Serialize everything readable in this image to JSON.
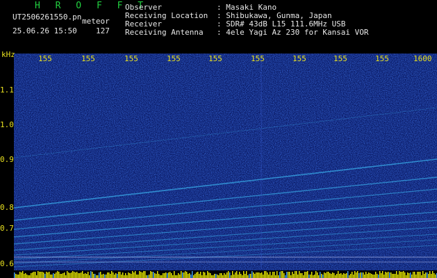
{
  "title": "H R O F F T",
  "file": {
    "name": "UT2506261550.pn",
    "kind": "meteor",
    "datetime": "25.06.26 15:50",
    "count": "127"
  },
  "info": [
    {
      "label": "Observer",
      "value": ": Masaki Kano"
    },
    {
      "label": "Receiving Location",
      "value": ": Shibukawa, Gunma, Japan"
    },
    {
      "label": "Receiver",
      "value": ": SDR# 43dB L15 111.6MHz USB"
    },
    {
      "label": "Receiving Antenna",
      "value": ": 4ele Yagi Az 230 for Kansai VOR"
    }
  ],
  "axis": {
    "y_unit": "kHz",
    "y_ticks": [
      "1.1",
      "1.0",
      "0.9",
      "0.8",
      "0.7",
      "0.6"
    ],
    "x_ticks": [
      "155",
      "155",
      "155",
      "155",
      "155",
      "155",
      "155",
      "155",
      "155",
      "1600"
    ]
  },
  "colors": {
    "background": "#000000",
    "spectrogram_bg": "#0a1a66",
    "signal": "#40c8ff",
    "meteor_bar": "#f0f000",
    "header_green": "#22d040"
  }
}
